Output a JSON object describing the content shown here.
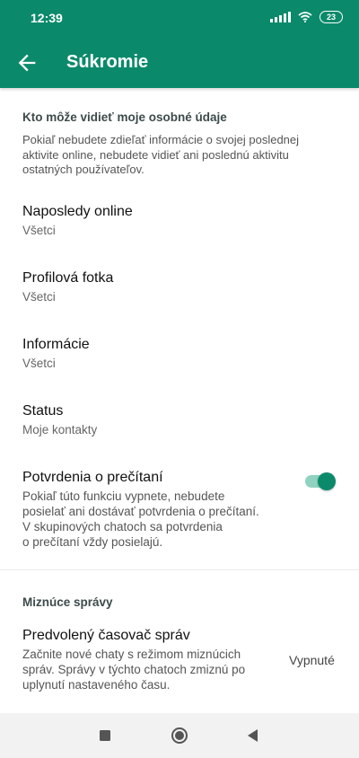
{
  "status_bar": {
    "time": "12:39",
    "battery": "23",
    "icons": [
      "signal-icon",
      "wifi-icon",
      "battery-icon"
    ]
  },
  "app_bar": {
    "title": "Súkromie",
    "back_icon": "arrow-back-icon",
    "color": "#0b8a6b"
  },
  "personal_info_section": {
    "header": "Kto môže vidieť moje osobné údaje",
    "description": "Pokiaľ nebudete zdieľať informácie o svojej poslednej aktivite online, nebudete vidieť ani poslednú aktivitu ostatných používateľov."
  },
  "settings": [
    {
      "label": "Naposledy online",
      "value": "Všetci"
    },
    {
      "label": "Profilová fotka",
      "value": "Všetci"
    },
    {
      "label": "Informácie",
      "value": "Všetci"
    },
    {
      "label": "Status",
      "value": "Moje kontakty"
    }
  ],
  "read_receipts": {
    "label": "Potvrdenia o prečítaní",
    "description_lines": [
      "Pokiaľ túto funkciu vypnete, nebudete",
      "posielať ani dostávať potvrdenia o prečítaní.",
      "V skupinových chatoch sa potvrdenia",
      "o prečítaní vždy posielajú."
    ],
    "enabled": true
  },
  "disappearing_section": {
    "header": "Miznúce správy",
    "timer": {
      "label": "Predvolený časovač správ",
      "description_lines": [
        "Začnite nové chaty s režimom miznúcich",
        "správ. Správy v týchto chatoch zmiznú po",
        "uplynutí nastaveného času."
      ],
      "value": "Vypnuté"
    }
  },
  "nav_bar": {
    "icons": [
      "square-recents-icon",
      "circle-home-icon",
      "triangle-back-icon"
    ]
  }
}
